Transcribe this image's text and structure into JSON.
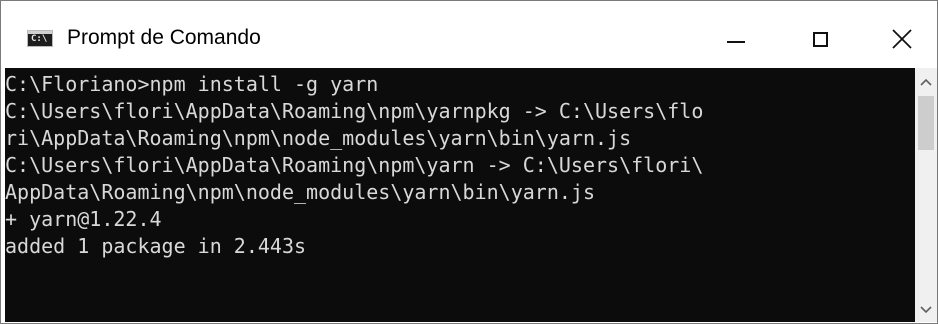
{
  "window": {
    "title": "Prompt de Comando",
    "icon_label": "C:\\",
    "icon": "console-app-icon"
  },
  "controls": {
    "minimize_icon": "minimize-icon",
    "maximize_icon": "maximize-icon",
    "close_icon": "close-icon"
  },
  "console": {
    "lines": [
      "C:\\Floriano>npm install -g yarn",
      "C:\\Users\\flori\\AppData\\Roaming\\npm\\yarnpkg -> C:\\Users\\flo",
      "ri\\AppData\\Roaming\\npm\\node_modules\\yarn\\bin\\yarn.js",
      "C:\\Users\\flori\\AppData\\Roaming\\npm\\yarn -> C:\\Users\\flori\\",
      "AppData\\Roaming\\npm\\node_modules\\yarn\\bin\\yarn.js",
      "+ yarn@1.22.4",
      "added 1 package in 2.443s"
    ],
    "foreground": "#d8d8d8",
    "background": "#0c0c0c"
  },
  "scrollbar": {
    "up_icon": "chevron-up-icon",
    "down_icon": "chevron-down-icon"
  }
}
